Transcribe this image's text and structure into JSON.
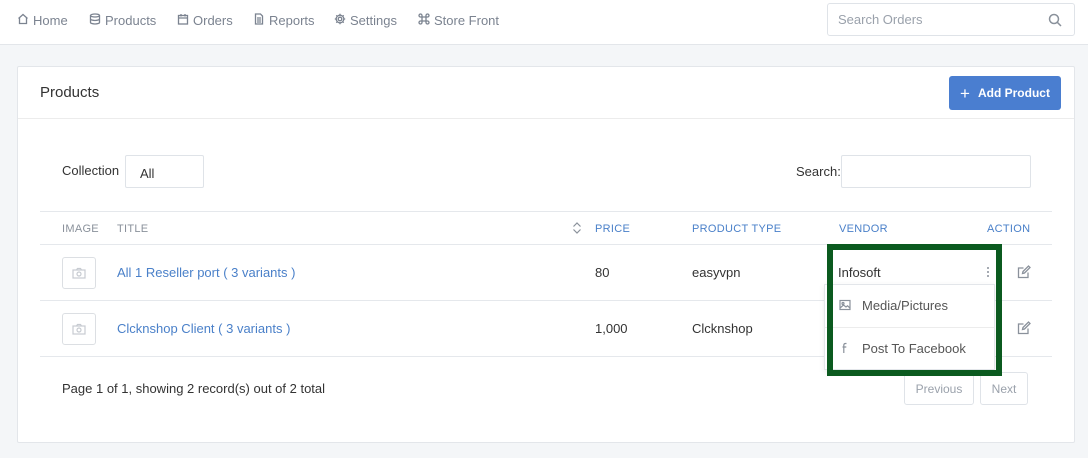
{
  "nav": {
    "items": [
      {
        "label": "Home",
        "icon": "home-icon"
      },
      {
        "label": "Products",
        "icon": "database-icon"
      },
      {
        "label": "Orders",
        "icon": "calendar-icon"
      },
      {
        "label": "Reports",
        "icon": "document-icon"
      },
      {
        "label": "Settings",
        "icon": "gear-icon"
      },
      {
        "label": "Store Front",
        "icon": "command-icon"
      }
    ],
    "search_placeholder": "Search Orders"
  },
  "card": {
    "title": "Products",
    "add_button": "Add Product",
    "collection_label": "Collection",
    "collection_value": "All",
    "search_label": "Search:"
  },
  "table": {
    "columns": [
      "IMAGE",
      "TITLE",
      "PRICE",
      "PRODUCT TYPE",
      "VENDOR",
      "ACTION"
    ],
    "rows": [
      {
        "title": "All 1 Reseller port ( 3 variants )",
        "price": "80",
        "product_type": "easyvpn",
        "vendor": "Infosoft"
      },
      {
        "title": "Clcknshop Client ( 3 variants )",
        "price": "1,000",
        "product_type": "Clcknshop",
        "vendor": ""
      }
    ]
  },
  "dropdown": {
    "items": [
      {
        "label": "Media/Pictures",
        "icon": "image-icon"
      },
      {
        "label": "Post To Facebook",
        "icon": "facebook-icon"
      }
    ]
  },
  "pagination": {
    "summary": "Page 1 of 1, showing 2 record(s) out of 2 total",
    "previous": "Previous",
    "next": "Next"
  },
  "colors": {
    "accent": "#4a7ed0",
    "link": "#4a80c9",
    "highlight": "#0b5a1f"
  }
}
